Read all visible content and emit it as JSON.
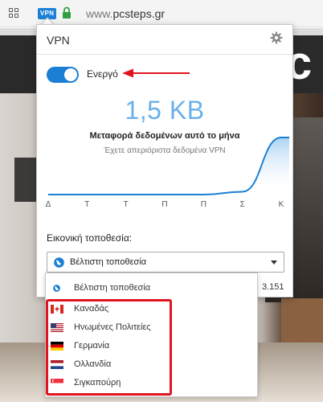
{
  "browser": {
    "vpn_badge": "VPN",
    "url_prefix": "www.",
    "url_domain": "pcsteps.gr",
    "icons": [
      "grid-icon",
      "lock-icon"
    ]
  },
  "popup": {
    "title": "VPN",
    "toggle": {
      "label": "Ενεργό",
      "on": true
    },
    "usage": {
      "amount": "1,5 KB",
      "period_label": "Μεταφορά δεδομένων αυτό το μήνα",
      "limit_note": "Έχετε απεριόριστα δεδομένα VPN"
    },
    "traffic_chart": {
      "days": [
        "Δ",
        "Τ",
        "Τ",
        "Π",
        "Π",
        "Σ",
        "Κ"
      ],
      "values": [
        0,
        0,
        0,
        0,
        0,
        0.05,
        1
      ]
    },
    "location": {
      "label": "Εικονική τοποθεσία:",
      "selected": "Βέλτιστη τοποθεσία",
      "options": [
        {
          "label": "Βέλτιστη τοποθεσία",
          "icon": "globe-icon"
        },
        {
          "label": "Καναδάς",
          "icon": "flag-canada-icon"
        },
        {
          "label": "Ηνωμένες Πολιτείες",
          "icon": "flag-usa-icon"
        },
        {
          "label": "Γερμανία",
          "icon": "flag-germany-icon"
        },
        {
          "label": "Ολλανδία",
          "icon": "flag-netherlands-icon"
        },
        {
          "label": "Σιγκαπούρη",
          "icon": "flag-singapore-icon"
        }
      ]
    },
    "behind_text": "3.151"
  },
  "colors": {
    "accent": "#1b7fd6",
    "usage_number": "#6ab0e8",
    "annotation": "#e0141e"
  }
}
